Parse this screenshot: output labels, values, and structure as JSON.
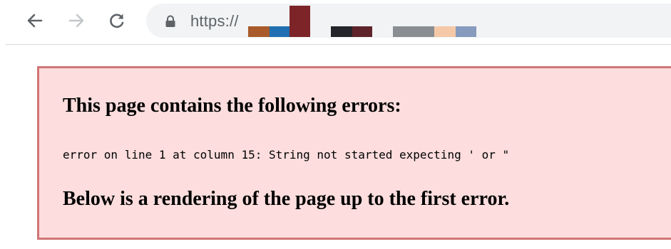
{
  "toolbar": {
    "back_icon": "arrow-left-icon",
    "forward_icon": "arrow-right-icon",
    "reload_icon": "reload-icon",
    "lock_icon": "lock-icon",
    "url_text": "https://",
    "redaction_colors": [
      "#a85a2a",
      "#1f6fb2",
      "#7d2428",
      "#23252a",
      "#5e2429",
      "#8a8d91",
      "#f5c9a8",
      "#869bbd"
    ]
  },
  "error": {
    "title": "This page contains the following errors:",
    "message": "error on line 1 at column 15: String not started expecting ' or \"",
    "below": "Below is a rendering of the page up to the first error.",
    "colors": {
      "background": "#fddddd",
      "border": "#d07575"
    }
  }
}
